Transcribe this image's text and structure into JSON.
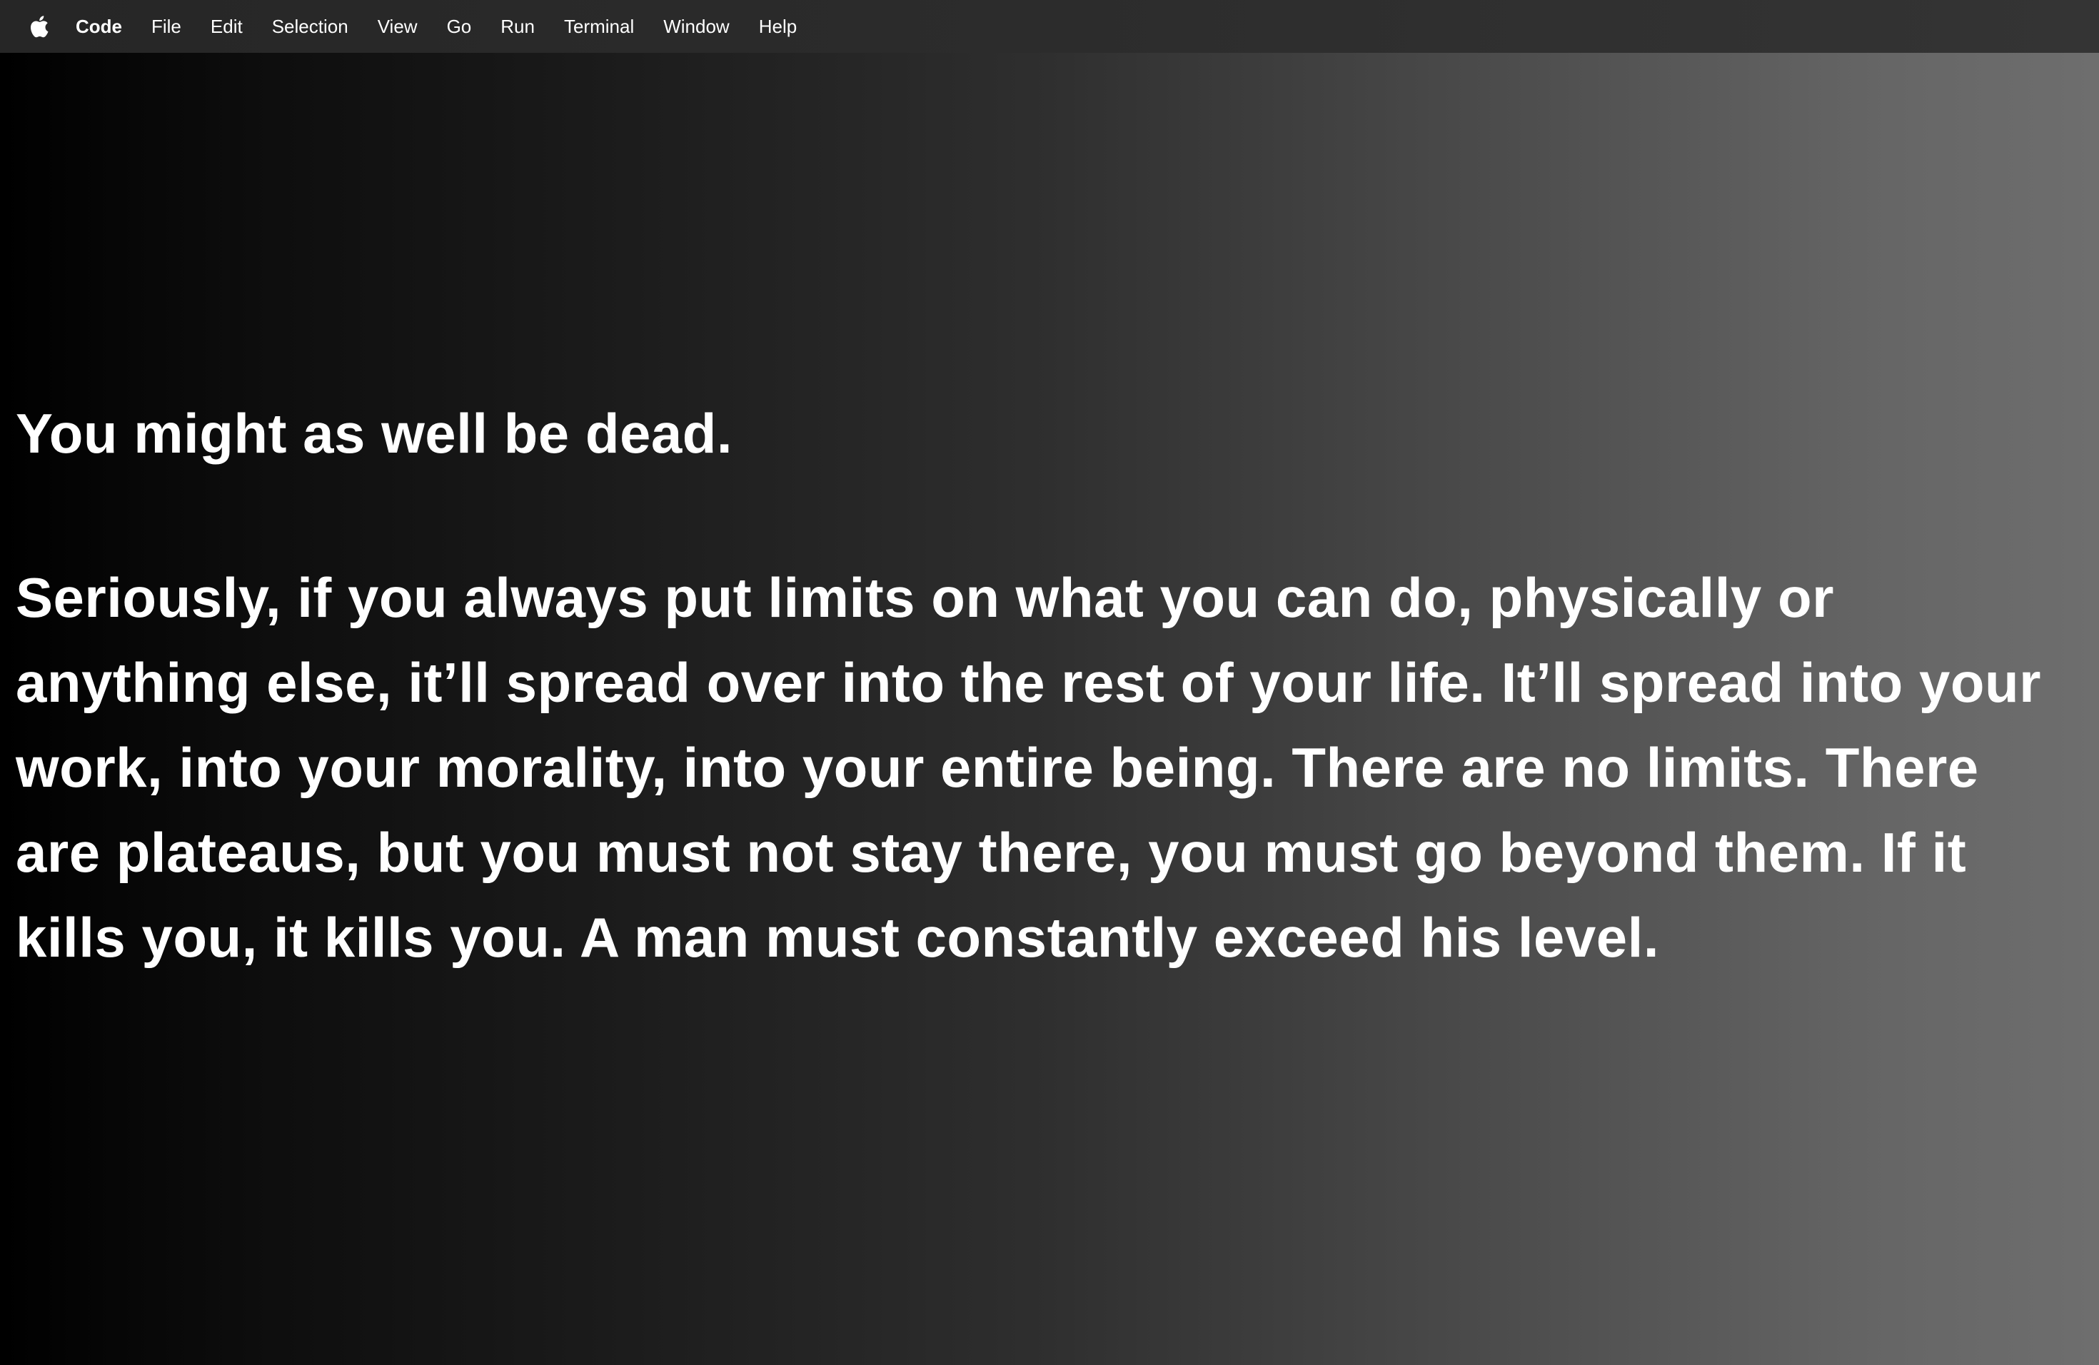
{
  "menubar": {
    "apple_icon": "apple-logo-icon",
    "items": [
      {
        "label": "Code"
      },
      {
        "label": "File"
      },
      {
        "label": "Edit"
      },
      {
        "label": "Selection"
      },
      {
        "label": "View"
      },
      {
        "label": "Go"
      },
      {
        "label": "Run"
      },
      {
        "label": "Terminal"
      },
      {
        "label": "Window"
      },
      {
        "label": "Help"
      }
    ]
  },
  "content": {
    "headline": "You might as well be dead.",
    "lines": [
      "Seriously, if you always put limits on what you can do, physically or",
      "anything else, it’ll spread over into the rest of your life. It’ll spread into your",
      "work, into your morality, into your entire being. There are no limits. There",
      "are plateaus, but you must not stay there, you must go beyond them. If it",
      "kills you, it kills you. A man must constantly exceed his level."
    ]
  },
  "colors": {
    "background_left": "#000000",
    "background_right": "#6e6e6e",
    "menubar": "#2c2c2c",
    "text": "#ffffff"
  }
}
